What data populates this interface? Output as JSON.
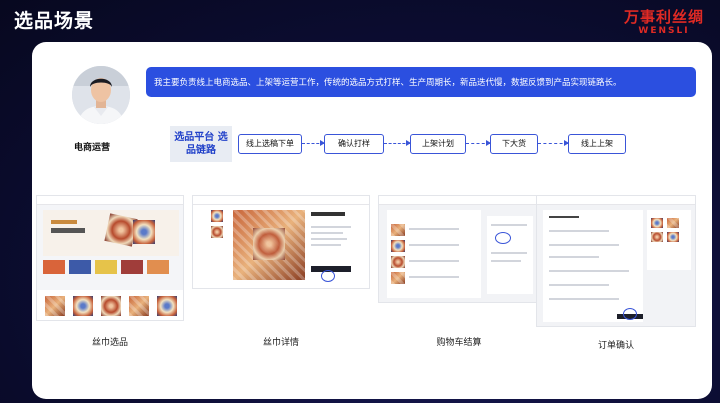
{
  "slide": {
    "title": "选品场景",
    "brand_cn": "万事利丝绸",
    "brand_en": "WENSLI"
  },
  "persona": {
    "role": "电商运营",
    "statement": "我主要负责线上电商选品、上架等运营工作，传统的选品方式打样、生产周期长，新品迭代慢，数据反馈到产品实现链路长。"
  },
  "chain": {
    "label": "选品平台 选品链路",
    "steps": [
      "线上选稿下单",
      "确认打样",
      "上架计划",
      "下大货",
      "线上上架"
    ]
  },
  "screens": [
    {
      "caption": "丝巾选品"
    },
    {
      "caption": "丝巾详情"
    },
    {
      "caption": "购物车结算"
    },
    {
      "caption": "订单确认"
    }
  ],
  "colors": {
    "accent": "#2b4fe0",
    "brand": "#e02a24",
    "background": "#0a0b2a"
  }
}
